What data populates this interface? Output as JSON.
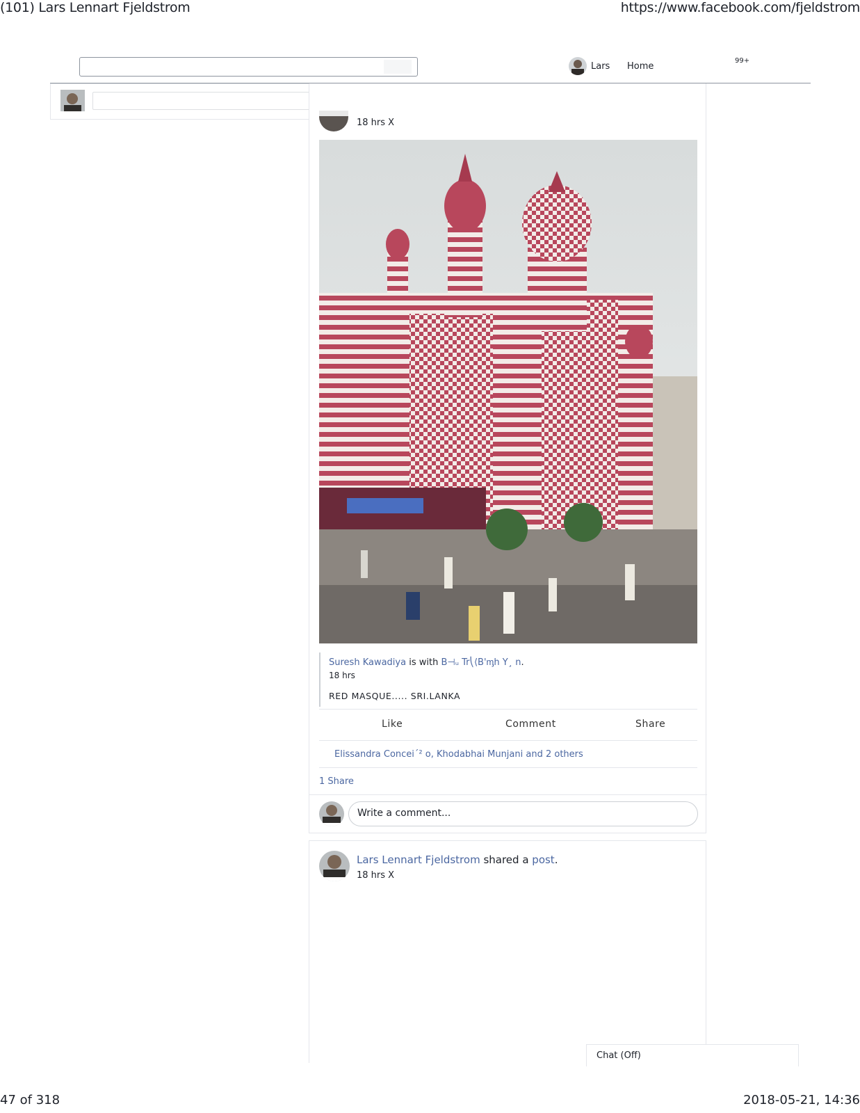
{
  "print": {
    "title": "(101) Lars Lennart Fjeldstrom",
    "url": "https://www.facebook.com/fjeldstrom",
    "page": "47 of 318",
    "datetime": "2018-05-21, 14:36"
  },
  "topbar": {
    "search_value": "",
    "user": "Lars",
    "home": "Home",
    "badge": "99+"
  },
  "post1": {
    "time": "18 hrs X",
    "shared": {
      "author": "Suresh Kawadiya",
      "with_text": " is with ",
      "with_names": "B⊣ᵤ Tr⎝⟨B'ᶆh Y¸ n",
      "end": ".",
      "time": "18 hrs",
      "text": "RED MASQUE..... SRI.LANKA"
    },
    "actions": {
      "like": "Like",
      "comment": "Comment",
      "share": "Share"
    },
    "reactions": "Elissandra Concei´² o, Khodabhai Munjani and 2 others",
    "shares": "1 Share",
    "comment_placeholder": "Write a comment..."
  },
  "post2": {
    "author": "Lars Lennart Fjeldstrom",
    "verb": " shared a ",
    "object": "post",
    "end": ".",
    "time": "18 hrs X"
  },
  "chat": {
    "label": "Chat (Off)"
  },
  "icons": {
    "profile_avatar": "profile-photo-avatar",
    "post_photo": "red-mosque-photo"
  }
}
